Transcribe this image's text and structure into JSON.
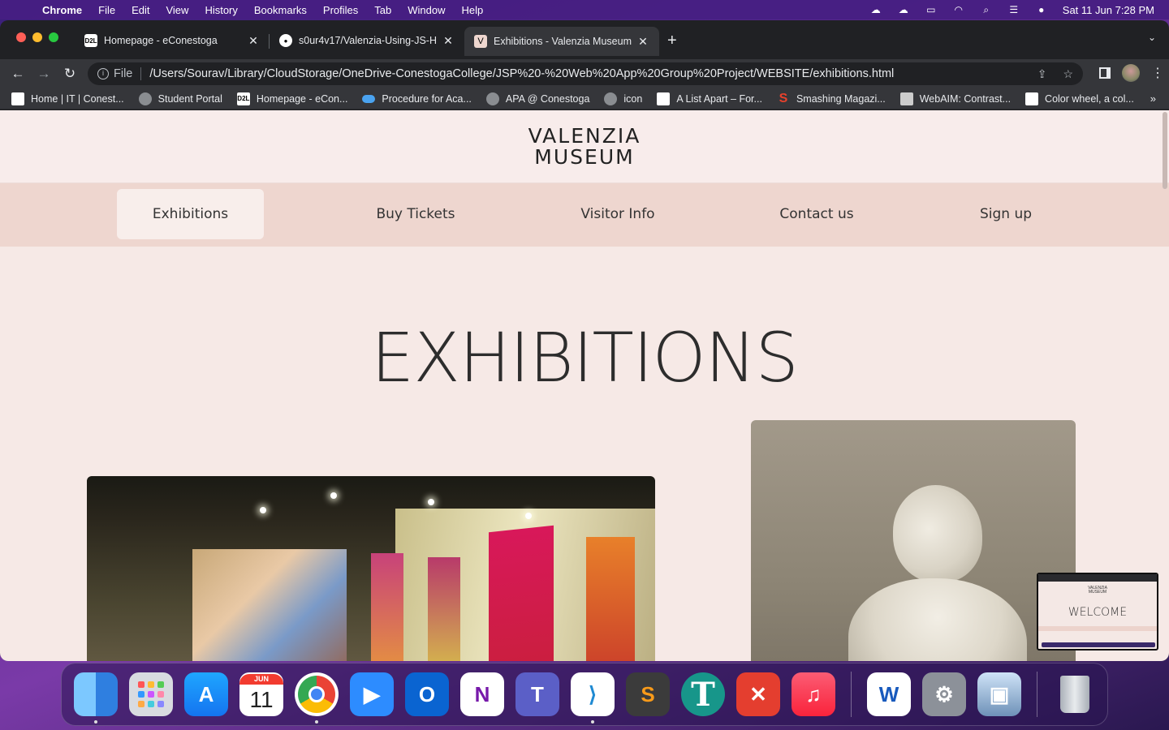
{
  "menubar": {
    "items": [
      "Chrome",
      "File",
      "Edit",
      "View",
      "History",
      "Bookmarks",
      "Profiles",
      "Tab",
      "Window",
      "Help"
    ],
    "clock": "Sat 11 Jun  7:28 PM"
  },
  "tabs": [
    {
      "label": "Homepage - eConestoga",
      "favicon": "D2L"
    },
    {
      "label": "s0ur4v17/Valenzia-Using-JS-H",
      "favicon": "github-icon"
    },
    {
      "label": "Exhibitions - Valenzia Museum",
      "favicon": "V"
    }
  ],
  "address": {
    "scheme": "File",
    "url": "/Users/Sourav/Library/CloudStorage/OneDrive-ConestogaCollege/JSP%20-%20Web%20App%20Group%20Project/WEBSITE/exhibitions.html"
  },
  "bookmarks": [
    {
      "label": "Home | IT | Conest..."
    },
    {
      "label": "Student Portal"
    },
    {
      "label": "Homepage - eCon..."
    },
    {
      "label": "Procedure for Aca..."
    },
    {
      "label": "APA @ Conestoga"
    },
    {
      "label": "icon"
    },
    {
      "label": "A List Apart – For..."
    },
    {
      "label": "Smashing Magazi..."
    },
    {
      "label": "WebAIM: Contrast..."
    },
    {
      "label": "Color wheel, a col..."
    }
  ],
  "site": {
    "logo_line1": "VALENZIA",
    "logo_line2": "MUSEUM",
    "nav": [
      "Exhibitions",
      "Buy Tickets",
      "Visitor Info",
      "Contact us",
      "Sign up"
    ],
    "page_title": "EXHIBITIONS"
  },
  "pip": {
    "logo_line1": "VALENZIA",
    "logo_line2": "MUSEUM",
    "title": "WELCOME"
  },
  "dock": {
    "calendar_month": "JUN",
    "calendar_day": "11"
  }
}
